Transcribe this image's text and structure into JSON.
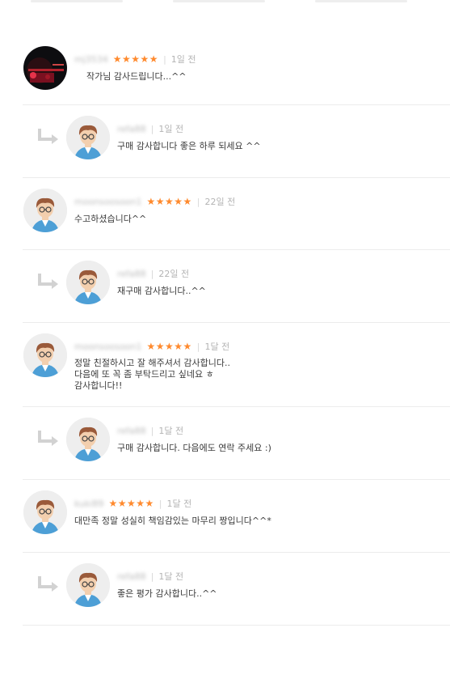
{
  "reviews": [
    {
      "type": "review",
      "username": "mj3534",
      "stars": "★★★★★",
      "date": "1일 전",
      "text": "작가님 감사드립니다...^^",
      "avatar": "photo"
    },
    {
      "type": "reply",
      "username": "refa88",
      "date": "1일 전",
      "text": "구매 감사합니다 좋은 하루 되세요 ^^"
    },
    {
      "type": "review",
      "username": "moonsoosoon1",
      "stars": "★★★★★",
      "date": "22일 전",
      "text": "수고하셨습니다^^",
      "avatar": "character"
    },
    {
      "type": "reply",
      "username": "refa88",
      "date": "22일 전",
      "text": "재구매 감사합니다..^^"
    },
    {
      "type": "review",
      "username": "moonsoosoon1",
      "stars": "★★★★★",
      "date": "1달 전",
      "text": "정말 친절하시고 잘 해주셔서 감사합니다..\n다음에 또 꼭 좀 부탁드리고 싶네요 ㅎ\n감사합니다!!",
      "avatar": "character"
    },
    {
      "type": "reply",
      "username": "refa88",
      "date": "1달 전",
      "text": "구매 감사합니다. 다음에도 연락 주세요 :)"
    },
    {
      "type": "review",
      "username": "kuki89",
      "stars": "★★★★★",
      "date": "1달 전",
      "text": "대만족 정말 성실히 책임감있는 마무리 짱입니다^^*",
      "avatar": "character"
    },
    {
      "type": "reply",
      "username": "refa88",
      "date": "1달 전",
      "text": "좋은 평가 감사합니다..^^"
    }
  ],
  "icons": {
    "reply_arrow": "reply-arrow-icon",
    "star": "star-icon"
  },
  "colors": {
    "star": "#ff8a2e",
    "divider": "#ececec",
    "date": "#b4b4b4",
    "text": "#3a3a3a"
  }
}
